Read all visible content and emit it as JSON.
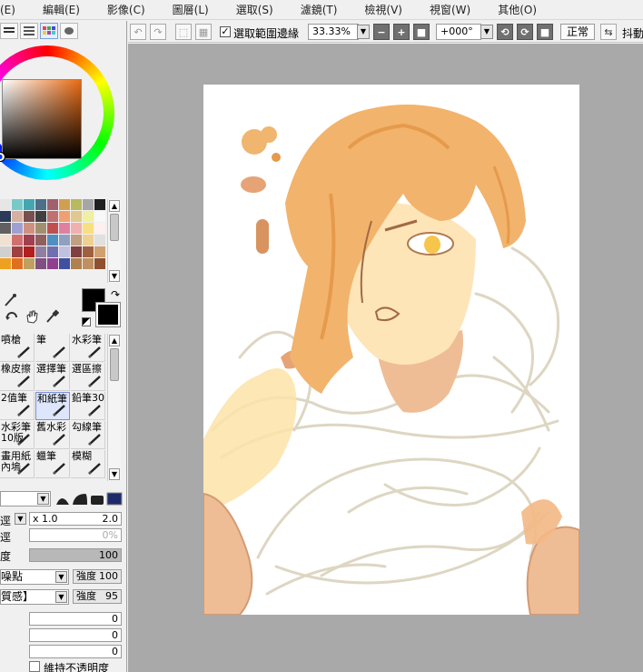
{
  "menu": [
    "(E)",
    "編輯(E)",
    "影像(C)",
    "圖層(L)",
    "選取(S)",
    "濾鏡(T)",
    "檢視(V)",
    "視窗(W)",
    "其他(O)"
  ],
  "toolbar": {
    "selection_edge_label": "選取範圍邊緣",
    "selection_edge_checked": true,
    "zoom": "33.33%",
    "rotation": "+000°",
    "blend_mode": "正常",
    "antishake_label": "抖動"
  },
  "swatches": [
    "#e6e6e6",
    "#7ac9c9",
    "#44a6b0",
    "#4d6f88",
    "#a0606e",
    "#d0a050",
    "#b9b95d",
    "#a6a6a6",
    "#202020",
    "#2a3a58",
    "#d6b0a0",
    "#785050",
    "#404040",
    "#c07070",
    "#f0a070",
    "#e0c890",
    "#f0f0a0",
    "#f8f8f8",
    "#606060",
    "#a0a0d0",
    "#d09080",
    "#a09070",
    "#c05050",
    "#e080a0",
    "#f0b0b0",
    "#f8e080",
    "#fff0f0",
    "#f0e0d0",
    "#d07070",
    "#a04050",
    "#906060",
    "#5090c0",
    "#90a0c0",
    "#c0a080",
    "#f0d090",
    "#e0e0e0",
    "#d0d0d0",
    "#a04040",
    "#b02020",
    "#9080a0",
    "#7070b0",
    "#c0c0e0",
    "#804040",
    "#a06040",
    "#d0a070",
    "#f0a020",
    "#e07020",
    "#c0a060",
    "#805080",
    "#904090",
    "#4050a0",
    "#b08050",
    "#c09060",
    "#905030"
  ],
  "tools": {
    "selection_icon": "lasso-select-icon",
    "hand_icon": "hand-icon",
    "rotate_icon": "rotate-icon",
    "eyedropper_icon": "eyedropper-icon",
    "fg_color": "#000000",
    "bg_color": "#000000"
  },
  "brushes": [
    {
      "name": "噴槍",
      "icon": "airbrush-icon"
    },
    {
      "name": "筆",
      "icon": "pen-icon"
    },
    {
      "name": "水彩筆",
      "icon": "watercolor-icon"
    },
    {
      "name": "橡皮擦",
      "icon": "eraser-icon"
    },
    {
      "name": "選擇筆",
      "icon": "select-pen-icon"
    },
    {
      "name": "選區擦",
      "icon": "select-eraser-icon"
    },
    {
      "name": "2值筆",
      "icon": "binary-pen-icon"
    },
    {
      "name": "和紙筆",
      "icon": "washi-pen-icon",
      "selected": true
    },
    {
      "name": "鉛筆30",
      "icon": "pencil-icon"
    },
    {
      "name": "水彩筆\n10版",
      "icon": "watercolor-icon"
    },
    {
      "name": "舊水彩",
      "icon": "old-watercolor-icon"
    },
    {
      "name": "勾線筆",
      "icon": "liner-icon"
    },
    {
      "name": "畫用紙\n內塢",
      "icon": "paper-icon"
    },
    {
      "name": "蠟筆",
      "icon": "crayon-icon"
    },
    {
      "name": "模糊",
      "icon": "blur-icon"
    }
  ],
  "brush_params": {
    "size_multiplier": "x 1.0",
    "size_value": "2.0",
    "min_size": "0%",
    "density": "100",
    "texture_1": "噪點",
    "texture_1_strength_label": "強度",
    "texture_1_strength": "100",
    "texture_2": "質感】",
    "texture_2_strength_label": "強度",
    "texture_2_strength": "95",
    "blend": "0",
    "dilution": "0",
    "persistence": "0",
    "keep_opacity_label": "維持不透明度",
    "labels": [
      "逕",
      "逕",
      "度"
    ]
  },
  "colors": {
    "hair": "#f2b36c",
    "hair_shadow": "#e59a4c",
    "skin": "#fde5b8",
    "skin_shadow": "#ebb594",
    "sketch": "#d8cfb8",
    "canvas_bg": "#a9a9a9"
  }
}
